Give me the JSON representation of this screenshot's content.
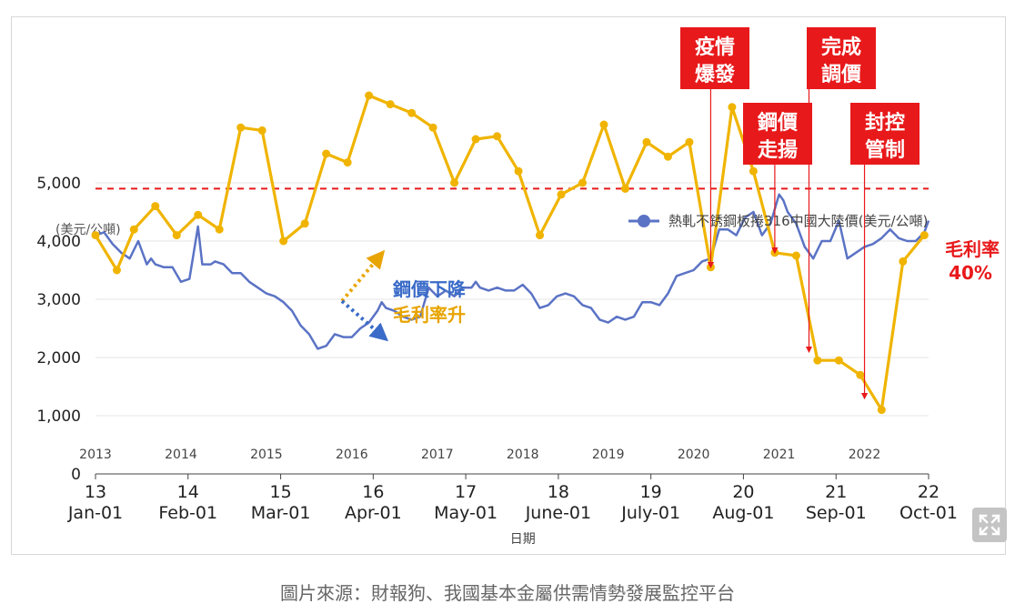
{
  "caption": "圖片來源：財報狗、我國基本金屬供需情勢發展監控平台",
  "expand_icon": "expand-icon",
  "chart_data": {
    "type": "line",
    "ylabel": "(美元/公噸)",
    "xlabel": "日期",
    "ylim": [
      0,
      5500
    ],
    "y_ticks": [
      0,
      1000,
      2000,
      3000,
      4000,
      5000
    ],
    "y_tick_labels": [
      "0",
      "1,000",
      "2,000",
      "3,000",
      "4,000",
      "5,000"
    ],
    "x_range": [
      2013.0,
      2022.75
    ],
    "x_ticks": [
      {
        "t": 2013.0,
        "year": "13",
        "month": "Jan-01"
      },
      {
        "t": 2014.083,
        "year": "14",
        "month": "Feb-01"
      },
      {
        "t": 2015.167,
        "year": "15",
        "month": "Mar-01"
      },
      {
        "t": 2016.25,
        "year": "16",
        "month": "Apr-01"
      },
      {
        "t": 2017.333,
        "year": "17",
        "month": "May-01"
      },
      {
        "t": 2018.417,
        "year": "18",
        "month": "June-01"
      },
      {
        "t": 2019.5,
        "year": "19",
        "month": "July-01"
      },
      {
        "t": 2020.583,
        "year": "20",
        "month": "Aug-01"
      },
      {
        "t": 2021.667,
        "year": "21",
        "month": "Sep-01"
      },
      {
        "t": 2022.75,
        "year": "22",
        "month": "Oct-01"
      }
    ],
    "year_labels": [
      {
        "t": 2013.0,
        "label": "2013"
      },
      {
        "t": 2014.0,
        "label": "2014"
      },
      {
        "t": 2015.0,
        "label": "2015"
      },
      {
        "t": 2016.0,
        "label": "2016"
      },
      {
        "t": 2017.0,
        "label": "2017"
      },
      {
        "t": 2018.0,
        "label": "2018"
      },
      {
        "t": 2019.0,
        "label": "2019"
      },
      {
        "t": 2020.0,
        "label": "2020"
      },
      {
        "t": 2021.0,
        "label": "2021"
      },
      {
        "t": 2022.0,
        "label": "2022"
      }
    ],
    "threshold": {
      "y": 4900,
      "label_line1": "毛利率",
      "label_line2": "40%",
      "color": "#e8191b"
    },
    "series": [
      {
        "name": "熱軋不銹鋼板捲316中國大陸價(美元/公噸)",
        "color": "#5b73c5",
        "x": [
          2013.0,
          2013.1,
          2013.2,
          2013.3,
          2013.4,
          2013.5,
          2013.6,
          2013.65,
          2013.7,
          2013.8,
          2013.9,
          2014.0,
          2014.1,
          2014.2,
          2014.25,
          2014.35,
          2014.4,
          2014.5,
          2014.6,
          2014.7,
          2014.8,
          2014.9,
          2015.0,
          2015.1,
          2015.2,
          2015.3,
          2015.4,
          2015.5,
          2015.6,
          2015.7,
          2015.8,
          2015.9,
          2016.0,
          2016.1,
          2016.15,
          2016.2,
          2016.3,
          2016.35,
          2016.4,
          2016.5,
          2016.6,
          2016.7,
          2016.8,
          2016.9,
          2017.0,
          2017.1,
          2017.2,
          2017.3,
          2017.4,
          2017.45,
          2017.5,
          2017.6,
          2017.7,
          2017.8,
          2017.9,
          2018.0,
          2018.1,
          2018.2,
          2018.3,
          2018.4,
          2018.5,
          2018.6,
          2018.7,
          2018.8,
          2018.9,
          2019.0,
          2019.1,
          2019.2,
          2019.3,
          2019.4,
          2019.5,
          2019.6,
          2019.7,
          2019.8,
          2019.9,
          2020.0,
          2020.1,
          2020.2,
          2020.3,
          2020.4,
          2020.5,
          2020.6,
          2020.7,
          2020.8,
          2020.9,
          2021.0,
          2021.05,
          2021.1,
          2021.2,
          2021.3,
          2021.4,
          2021.5,
          2021.6,
          2021.7,
          2021.8,
          2021.9,
          2022.0,
          2022.1,
          2022.2,
          2022.3,
          2022.4,
          2022.5,
          2022.6,
          2022.7,
          2022.75
        ],
        "values": [
          4100,
          4150,
          3950,
          3800,
          3700,
          4000,
          3600,
          3700,
          3600,
          3550,
          3550,
          3300,
          3350,
          4250,
          3600,
          3600,
          3650,
          3600,
          3450,
          3450,
          3300,
          3200,
          3100,
          3050,
          2950,
          2800,
          2550,
          2400,
          2150,
          2200,
          2400,
          2350,
          2350,
          2500,
          2550,
          2600,
          2800,
          2950,
          2850,
          2800,
          2700,
          2650,
          2700,
          3200,
          3050,
          3150,
          3050,
          3200,
          3200,
          3300,
          3200,
          3150,
          3200,
          3150,
          3150,
          3250,
          3100,
          2850,
          2900,
          3050,
          3100,
          3050,
          2900,
          2850,
          2650,
          2600,
          2700,
          2650,
          2700,
          2950,
          2950,
          2900,
          3100,
          3400,
          3450,
          3500,
          3650,
          3700,
          4200,
          4200,
          4100,
          4400,
          4500,
          4100,
          4300,
          4800,
          4700,
          4500,
          4300,
          3900,
          3700,
          4000,
          4000,
          4350,
          3700,
          3800,
          3900,
          3950,
          4050,
          4200,
          4050,
          4000,
          4000,
          4150,
          4350
        ]
      },
      {
        "name": "毛利率",
        "color": "#f0b400",
        "x": [
          2013.0,
          2013.25,
          2013.45,
          2013.7,
          2013.95,
          2014.2,
          2014.45,
          2014.7,
          2014.95,
          2015.2,
          2015.45,
          2015.7,
          2015.95,
          2016.2,
          2016.45,
          2016.7,
          2016.95,
          2017.2,
          2017.45,
          2017.7,
          2017.95,
          2018.2,
          2018.45,
          2018.7,
          2018.95,
          2019.2,
          2019.45,
          2019.7,
          2019.95,
          2020.2,
          2020.45,
          2020.7,
          2020.95,
          2021.2,
          2021.45,
          2021.7,
          2021.95,
          2022.2,
          2022.45,
          2022.7
        ],
        "values": [
          4100,
          3500,
          4200,
          4600,
          4100,
          4450,
          4200,
          5950,
          5900,
          4000,
          4300,
          5500,
          5350,
          6500,
          6350,
          6200,
          5950,
          5000,
          5750,
          5800,
          5200,
          4100,
          4800,
          5000,
          6000,
          4900,
          5700,
          5450,
          5700,
          3550,
          6300,
          5200,
          3800,
          3750,
          1950,
          1950,
          1700,
          1100,
          3650,
          4100
        ]
      }
    ],
    "annotations": [
      {
        "name": "pandemic",
        "line1": "疫情",
        "line2": "爆發",
        "t": 2020.2,
        "arrow_to": 3550
      },
      {
        "name": "steel-rise",
        "line1": "鋼價",
        "line2": "走揚",
        "t": 2020.95,
        "arrow_to": 3800
      },
      {
        "name": "price-adjust",
        "line1": "完成",
        "line2": "調價",
        "t": 2021.35,
        "arrow_to": 2100
      },
      {
        "name": "lockdown",
        "line1": "封控",
        "line2": "管制",
        "t": 2022.0,
        "arrow_to": 1300
      }
    ],
    "inline_notes": {
      "line1": "鋼價下降",
      "line2": "毛利率升",
      "color1": "#3a6bc8",
      "color2": "#e8a400"
    }
  }
}
